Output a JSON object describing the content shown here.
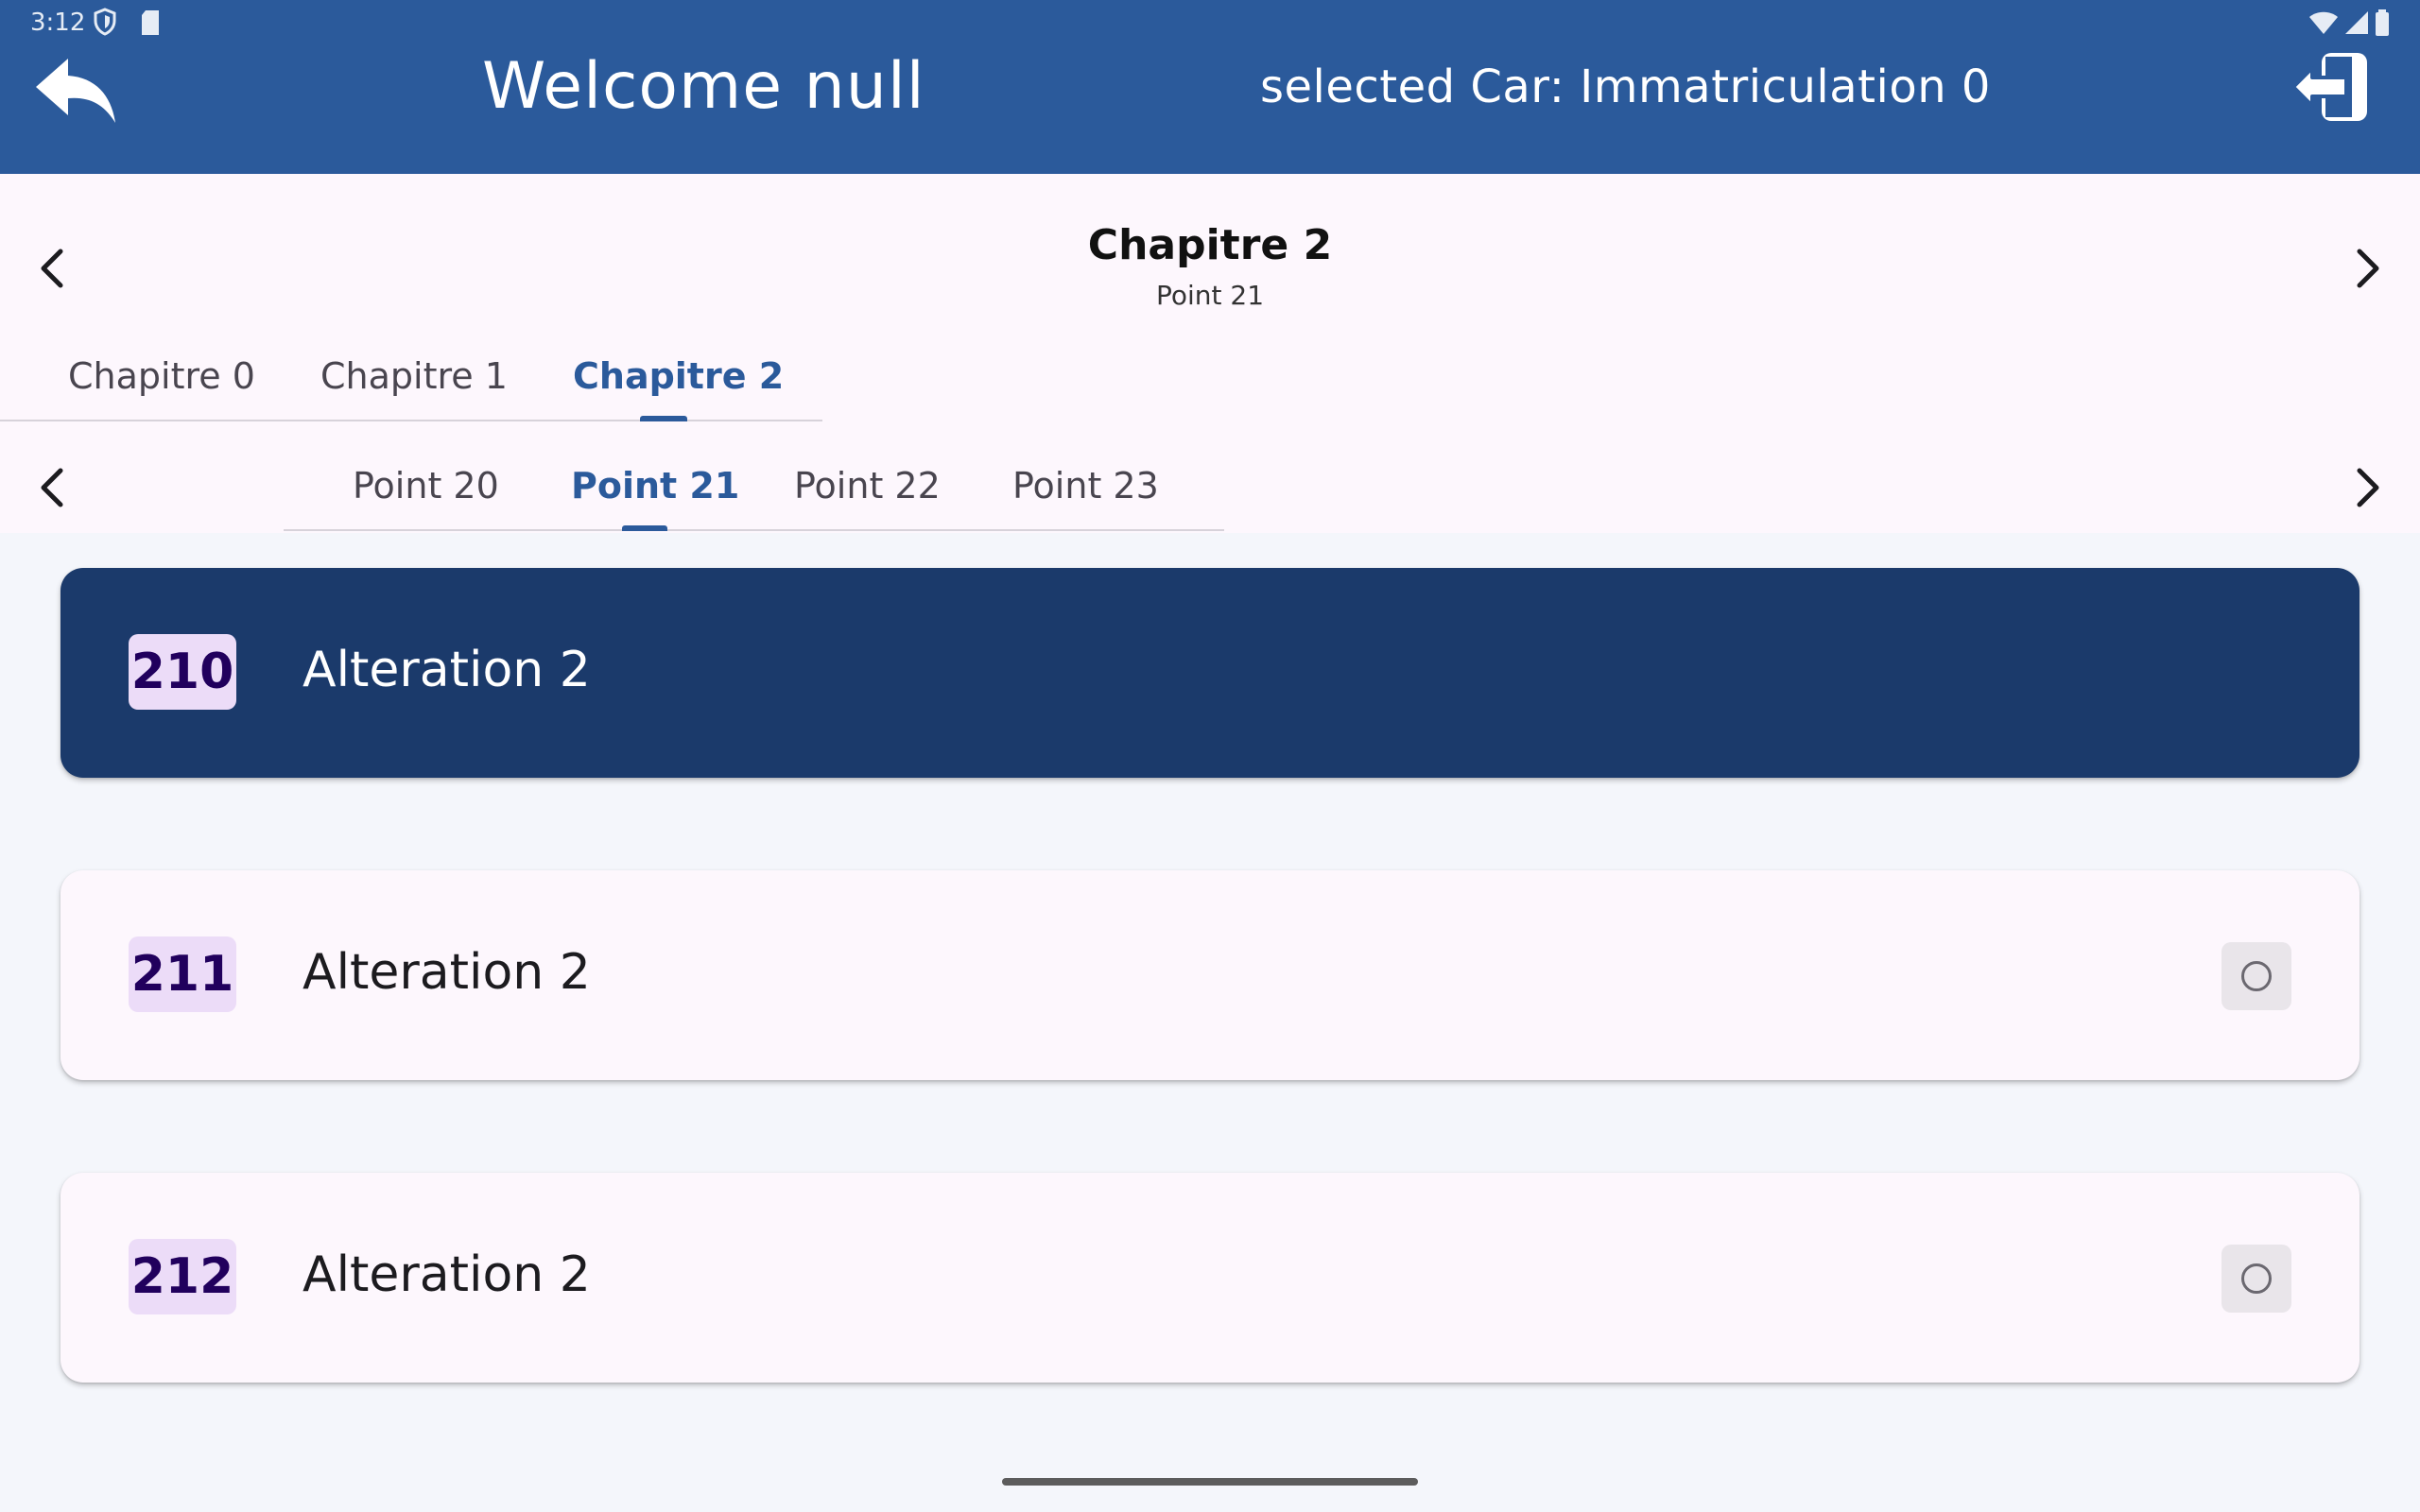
{
  "status_bar": {
    "time": "3:12"
  },
  "app_bar": {
    "welcome": "Welcome null",
    "selected_car": "selected Car: Immatriculation 0",
    "color": "#2b5a9b"
  },
  "header": {
    "chapter_title": "Chapitre 2",
    "point_subtitle": "Point 21"
  },
  "chapter_tabs": [
    {
      "label": "Chapitre 0",
      "active": false
    },
    {
      "label": "Chapitre 1",
      "active": false
    },
    {
      "label": "Chapitre 2",
      "active": true
    }
  ],
  "point_tabs": [
    {
      "label": "Point 20",
      "active": false
    },
    {
      "label": "Point 21",
      "active": true
    },
    {
      "label": "Point 22",
      "active": false
    },
    {
      "label": "Point 23",
      "active": false
    }
  ],
  "items": [
    {
      "code": "210",
      "label": "Alteration 2",
      "selected": true
    },
    {
      "code": "211",
      "label": "Alteration 2",
      "selected": false
    },
    {
      "code": "212",
      "label": "Alteration 2",
      "selected": false
    }
  ],
  "colors": {
    "accent": "#2b5a9b",
    "selected_card": "#1b3a6b",
    "badge": "#ecdcf8"
  },
  "icons": {
    "back": "reply-arrow-icon",
    "logout": "logout-icon",
    "prev": "chevron-left-icon",
    "next": "chevron-right-icon",
    "radio": "radio-unchecked-icon"
  }
}
